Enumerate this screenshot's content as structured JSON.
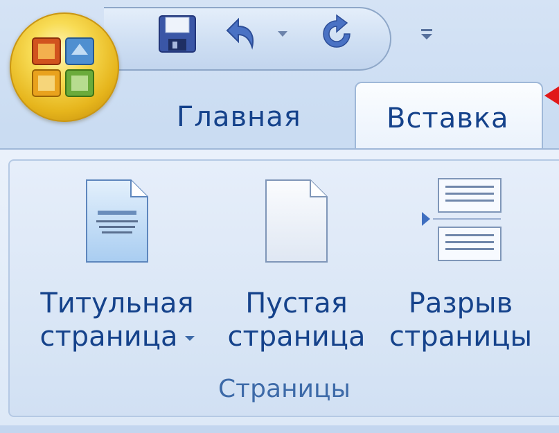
{
  "quick_access": {
    "save_icon": "save-icon",
    "undo_icon": "undo-icon",
    "redo_icon": "redo-icon",
    "customize_icon": "customize-qat-icon"
  },
  "office_button": {
    "icon": "office-logo-icon"
  },
  "tabs": [
    {
      "label": "Главная"
    },
    {
      "label": "Вставка"
    }
  ],
  "ribbon": {
    "group_title": "Страницы",
    "buttons": [
      {
        "line1": "Титульная",
        "line2": "страница",
        "icon": "cover-page-icon"
      },
      {
        "line1": "Пустая",
        "line2": "страница",
        "icon": "blank-page-icon"
      },
      {
        "line1": "Разрыв",
        "line2": "страницы",
        "icon": "page-break-icon"
      }
    ]
  },
  "colors": {
    "tab_text": "#15428b",
    "group_title": "#3d6aa8",
    "pointer_arrow": "#e11818"
  }
}
